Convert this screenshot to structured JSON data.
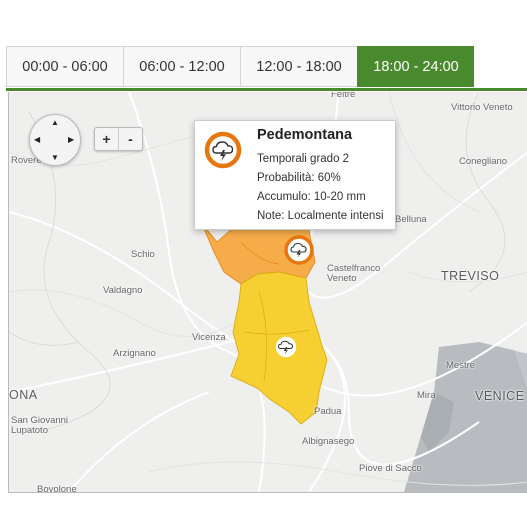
{
  "tabs": [
    {
      "label": "00:00 - 06:00",
      "active": false
    },
    {
      "label": "06:00 - 12:00",
      "active": false
    },
    {
      "label": "12:00 - 18:00",
      "active": false
    },
    {
      "label": "18:00 - 24:00",
      "active": true
    }
  ],
  "controls": {
    "zoom_in": "+",
    "zoom_out": "-"
  },
  "popup": {
    "title": "Pedemontana",
    "lines": [
      "Temporali grado 2",
      "Probabilità: 60%",
      "Accumulo: 10-20 mm",
      "Note: Localmente intensi"
    ],
    "icon": "thunderstorm-icon",
    "icon_ring_color": "#e8760e"
  },
  "zones": [
    {
      "name": "Pedemontana",
      "alert_color": "#f7a940",
      "icon": "thunderstorm-icon"
    },
    {
      "name": "",
      "alert_color": "#f7cf2a",
      "icon": "thunderstorm-icon"
    }
  ],
  "places": [
    "Feltre",
    "Vittorio Veneto",
    "Rovereto",
    "Conegliano",
    "Belluna",
    "Schio",
    "Castelfranco Veneto",
    "TREVISO",
    "Valdagno",
    "Vicenza",
    "Arzignano",
    "Mestre",
    "ONA",
    "San Giovanni Lupatoto",
    "Padua",
    "Mira",
    "VENICE",
    "Albignasego",
    "Piove di Sacco",
    "Bovolone"
  ]
}
